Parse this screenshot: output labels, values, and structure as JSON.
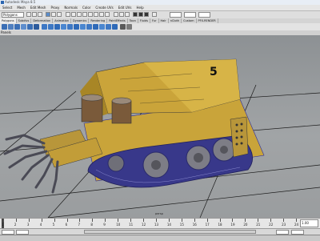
{
  "window": {
    "title": "Autodesk Maya 8.5"
  },
  "menus": [
    "Select",
    "Mesh",
    "Edit Mesh",
    "Proxy",
    "Normals",
    "Color",
    "Create UVs",
    "Edit UVs",
    "Help"
  ],
  "status_line": {
    "mode": "Polygons"
  },
  "shelf_tabs": [
    "Polygons",
    "Subdivs",
    "Deformation",
    "Animation",
    "Dynamics",
    "Rendering",
    "PaintEffects",
    "Toon",
    "Fluids",
    "Fur",
    "Hair",
    "nCloth",
    "Custom",
    "PFX-RENDER"
  ],
  "panel": {
    "label": "Panels",
    "camera_label": "persp"
  },
  "vehicle": {
    "number": "5"
  },
  "time_slider": {
    "ticks": [
      "1",
      "2",
      "3",
      "4",
      "5",
      "6",
      "7",
      "8",
      "9",
      "10",
      "11",
      "12",
      "13",
      "14",
      "15",
      "16",
      "17",
      "18",
      "19",
      "20",
      "21",
      "22",
      "23",
      "24"
    ],
    "current_time": "1.00"
  },
  "colors": {
    "viewport_bg": "#969a9d",
    "grid_line": "#1a1a1a",
    "wireframe": "#2a2aa0",
    "hull_yellow": "#c9a43a"
  }
}
